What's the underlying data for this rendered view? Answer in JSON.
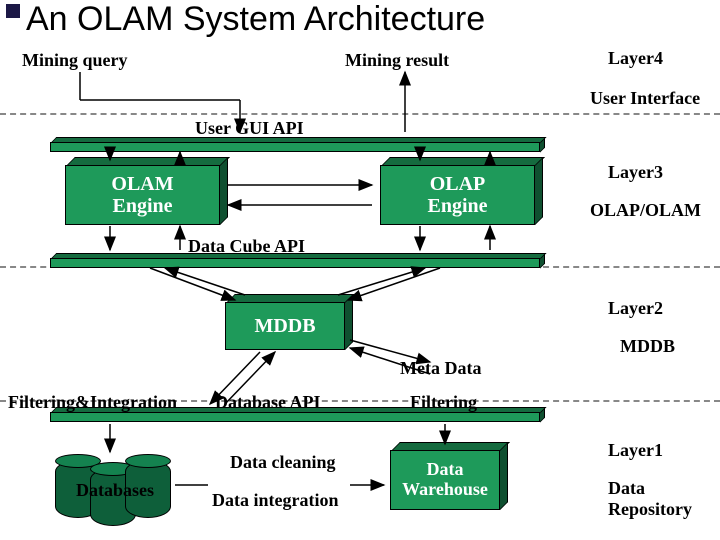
{
  "title": "An OLAM System Architecture",
  "labels": {
    "mining_query": "Mining query",
    "mining_result": "Mining result",
    "user_gui_api": "User GUI API",
    "data_cube_api": "Data Cube API",
    "database_api": "Database API",
    "filtering_integration": "Filtering&Integration",
    "filtering": "Filtering",
    "data_cleaning": "Data cleaning",
    "data_integration": "Data integration",
    "meta_data": "Meta Data"
  },
  "boxes": {
    "olam_engine": "OLAM\nEngine",
    "olap_engine": "OLAP\nEngine",
    "mddb": "MDDB",
    "data_warehouse": "Data\nWarehouse",
    "databases": "Databases"
  },
  "layers": {
    "l4_name": "Layer4",
    "l4_desc": "User Interface",
    "l3_name": "Layer3",
    "l3_desc": "OLAP/OLAM",
    "l2_name": "Layer2",
    "l2_desc": "MDDB",
    "l1_name": "Layer1",
    "l1_desc": "Data Repository"
  }
}
